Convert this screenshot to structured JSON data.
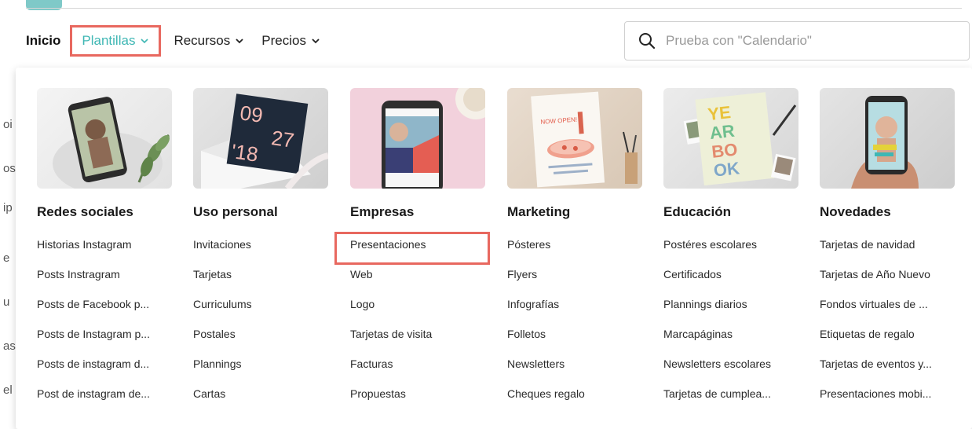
{
  "nav": {
    "inicio": "Inicio",
    "plantillas": "Plantillas",
    "recursos": "Recursos",
    "precios": "Precios"
  },
  "search": {
    "placeholder": "Prueba con \"Calendario\""
  },
  "leftstrip": [
    "oi",
    "os",
    "ip",
    "e",
    "u",
    "as",
    "el"
  ],
  "columns": [
    {
      "title": "Redes sociales",
      "items": [
        "Historias Instagram",
        "Posts Instragram",
        "Posts de Facebook p...",
        "Posts de Instagram p...",
        "Posts de instagram d...",
        "Post de instagram de..."
      ]
    },
    {
      "title": "Uso personal",
      "items": [
        "Invitaciones",
        "Tarjetas",
        "Curriculums",
        "Postales",
        "Plannings",
        "Cartas"
      ]
    },
    {
      "title": "Empresas",
      "items": [
        "Presentaciones",
        "Web",
        "Logo",
        "Tarjetas de visita",
        "Facturas",
        "Propuestas"
      ]
    },
    {
      "title": "Marketing",
      "items": [
        "Pósteres",
        "Flyers",
        "Infografías",
        "Folletos",
        "Newsletters",
        "Cheques regalo"
      ]
    },
    {
      "title": "Educación",
      "items": [
        "Postéres escolares",
        "Certificados",
        "Plannings diarios",
        "Marcapáginas",
        "Newsletters escolares",
        "Tarjetas de cumplea..."
      ]
    },
    {
      "title": "Novedades",
      "items": [
        "Tarjetas de navidad",
        "Tarjetas de Año Nuevo",
        "Fondos virtuales de ...",
        "Etiquetas de regalo",
        "Tarjetas de eventos y...",
        "Presentaciones mobi..."
      ]
    }
  ],
  "thumb_text": {
    "date_line1": "09",
    "date_line2": "27",
    "date_line3": "'18",
    "now_open": "NOW OPEN!",
    "yearbook": [
      "YE",
      "AR",
      "BO",
      "OK"
    ]
  },
  "colors": {
    "accent": "#3fb7b4",
    "highlight": "#e8685f"
  }
}
